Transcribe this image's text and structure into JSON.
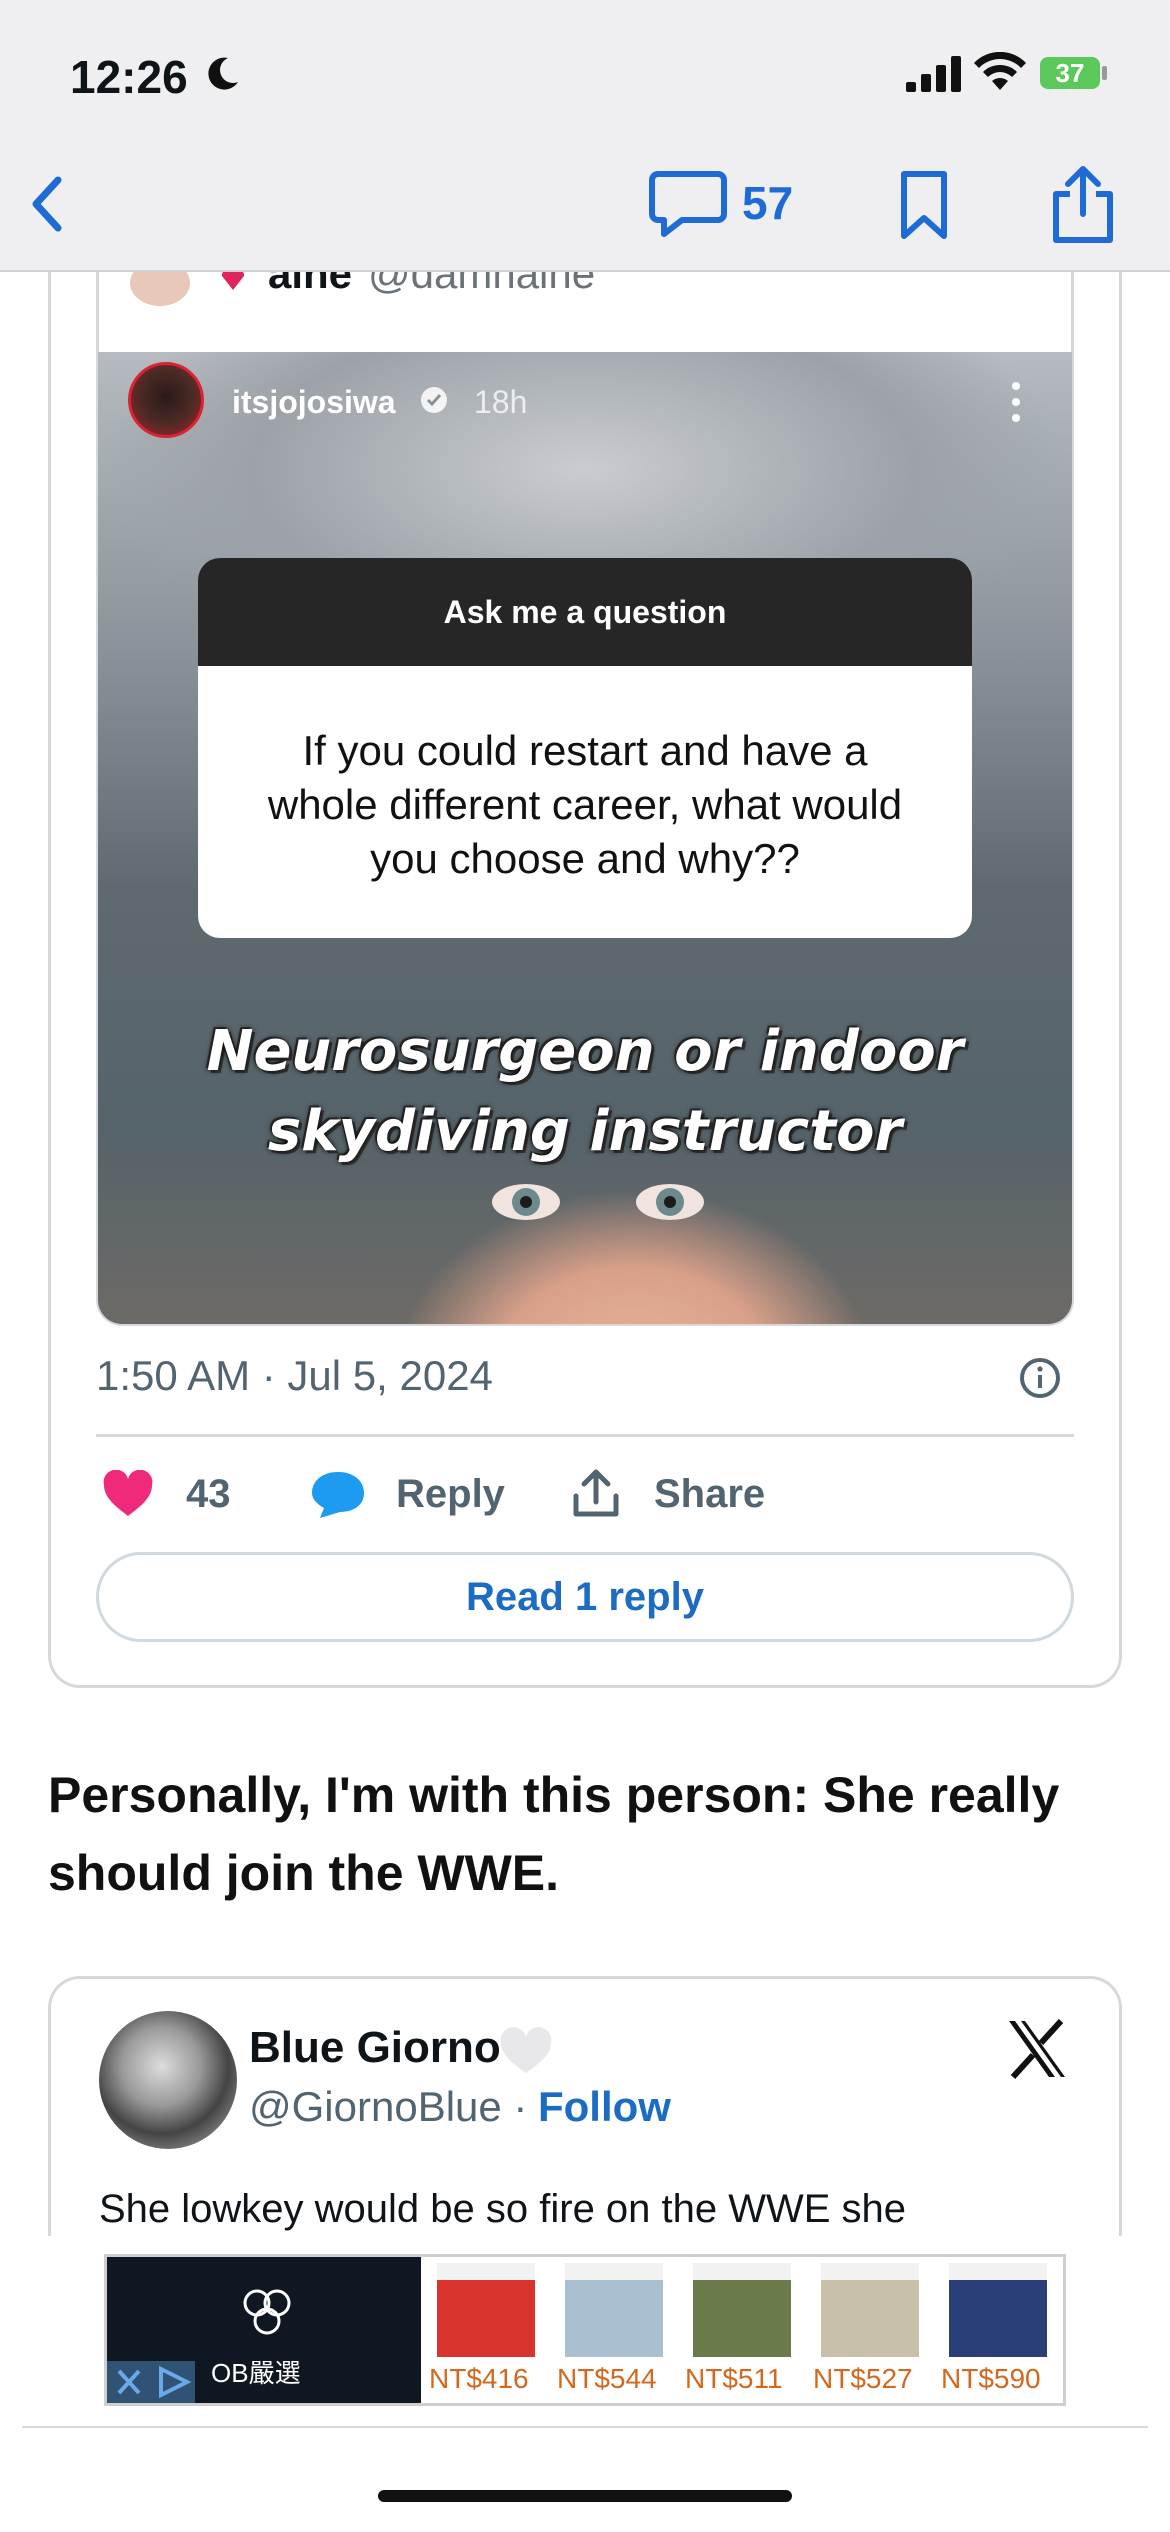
{
  "status_bar": {
    "time": "12:26",
    "battery": "37"
  },
  "nav": {
    "comment_count": "57"
  },
  "quoted_tweet": {
    "author_partial": "aine",
    "handle_partial": "@damnaine"
  },
  "story": {
    "username": "itsjojosiwa",
    "time": "18h",
    "question_header": "Ask me a question",
    "question": "If you could restart and have a whole different career, what would you choose and why??",
    "answer": "Neurosurgeon or indoor skydiving instructor"
  },
  "tweet1": {
    "timestamp": "1:50 AM · Jul 5, 2024",
    "likes": "43",
    "reply_label": "Reply",
    "share_label": "Share",
    "read_reply_label": "Read 1 reply"
  },
  "article": {
    "paragraph": "Personally, I'm with this person: She really should join the WWE."
  },
  "tweet2": {
    "name": "Blue Giorno",
    "handle": "@GiornoBlue ·",
    "follow_label": "Follow",
    "text": "She lowkey would be so fire on the WWE  she"
  },
  "ad": {
    "brand": "OB嚴選",
    "items": [
      {
        "price": "NT$416",
        "color": "#d8332c"
      },
      {
        "price": "NT$544",
        "color": "#a8c0d0"
      },
      {
        "price": "NT$511",
        "color": "#6b7a4a"
      },
      {
        "price": "NT$527",
        "color": "#c8c0a8"
      },
      {
        "price": "NT$590",
        "color": "#2a3e78"
      }
    ]
  },
  "colors": {
    "link_blue": "#1d6cc4",
    "like_pink": "#f02a7a",
    "reply_blue": "#1d9bf0"
  }
}
